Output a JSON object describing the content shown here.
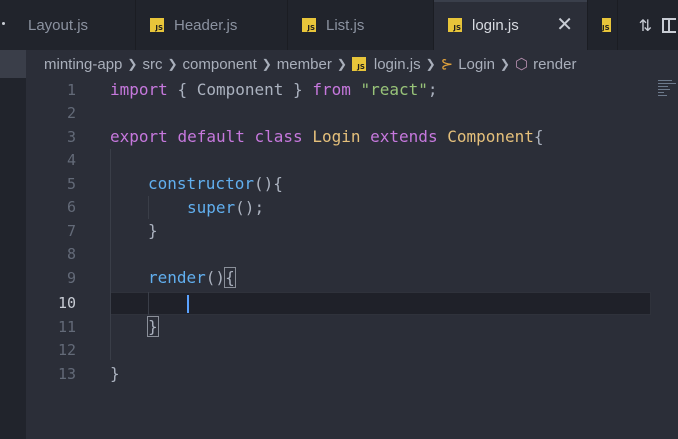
{
  "tabs": [
    {
      "label": "Layout.js",
      "icon": "js-file-icon"
    },
    {
      "label": "Header.js",
      "icon": "js-file-icon"
    },
    {
      "label": "List.js",
      "icon": "js-file-icon"
    },
    {
      "label": "login.js",
      "icon": "js-file-icon",
      "active": true
    }
  ],
  "js_badge": "JS",
  "close_glyph": "✕",
  "breadcrumb": {
    "segments": [
      "minting-app",
      "src",
      "component",
      "member"
    ],
    "file": "login.js",
    "class_symbol": "Login",
    "method_symbol": "render"
  },
  "editor": {
    "current_line": 10,
    "line_numbers": [
      "1",
      "2",
      "3",
      "4",
      "5",
      "6",
      "7",
      "8",
      "9",
      "10",
      "11",
      "12",
      "13"
    ],
    "tokens": {
      "l1_import": "import",
      "l1_brace_open": "{ Component }",
      "l1_from": "from",
      "l1_str": "\"react\"",
      "l1_semi": ";",
      "l3_export": "export",
      "l3_default": "default",
      "l3_class": "class",
      "l3_name": "Login",
      "l3_extends": "extends",
      "l3_parent": "Component",
      "l3_brace": "{",
      "l5_ctor": "constructor",
      "l5_rest": "(){",
      "l6_super": "super",
      "l6_rest": "();",
      "l7_close": "}",
      "l9_render": "render",
      "l9_paren": "()",
      "l9_brace": "{",
      "l11_close": "}",
      "l13_close": "}"
    }
  },
  "colors": {
    "keyword": "#c678dd",
    "function": "#61afef",
    "class": "#e5c07b",
    "string": "#98c379",
    "background": "#2b2e38"
  }
}
